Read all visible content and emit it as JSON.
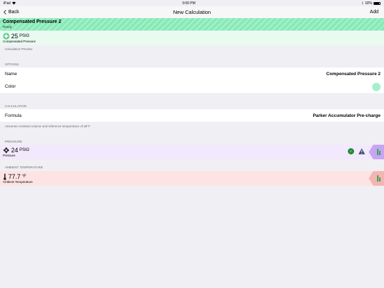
{
  "status_bar": {
    "carrier": "iPad",
    "time": "9:00 PM",
    "battery": "92%"
  },
  "nav": {
    "back_label": "Back",
    "title": "New Calculation",
    "add_label": "Add"
  },
  "preview": {
    "title": "Compensated Pressure 2",
    "status": "Ready",
    "value": "25",
    "unit": "PSIG",
    "label": "Compensated Pressure",
    "caption": "Calculation Preview"
  },
  "options": {
    "header": "OPTIONS",
    "name_label": "Name",
    "name_value": "Compensated Pressure 2",
    "color_label": "Color",
    "color_value": "#a4f0cb"
  },
  "calculation": {
    "header": "CALCULATION",
    "formula_label": "Formula",
    "formula_value": "Parker Accumulator Pre-charge",
    "footer": "Assumes constant volume and reference temperature of 68°F"
  },
  "pressure": {
    "header": "PRESSURE",
    "value": "24",
    "unit": "PSIG",
    "label": "Pressure"
  },
  "ambient": {
    "header": "AMBIENT TEMPERATURE",
    "value": "77.7",
    "unit": "°F",
    "label": "Ambient Temperature"
  },
  "colors": {
    "accent": "#007aff",
    "pressure_bg": "#f2e9fd",
    "pressure_tab": "#c8a4f5",
    "ambient_bg": "#fde3e3",
    "ambient_tab": "#f5b4b4"
  }
}
